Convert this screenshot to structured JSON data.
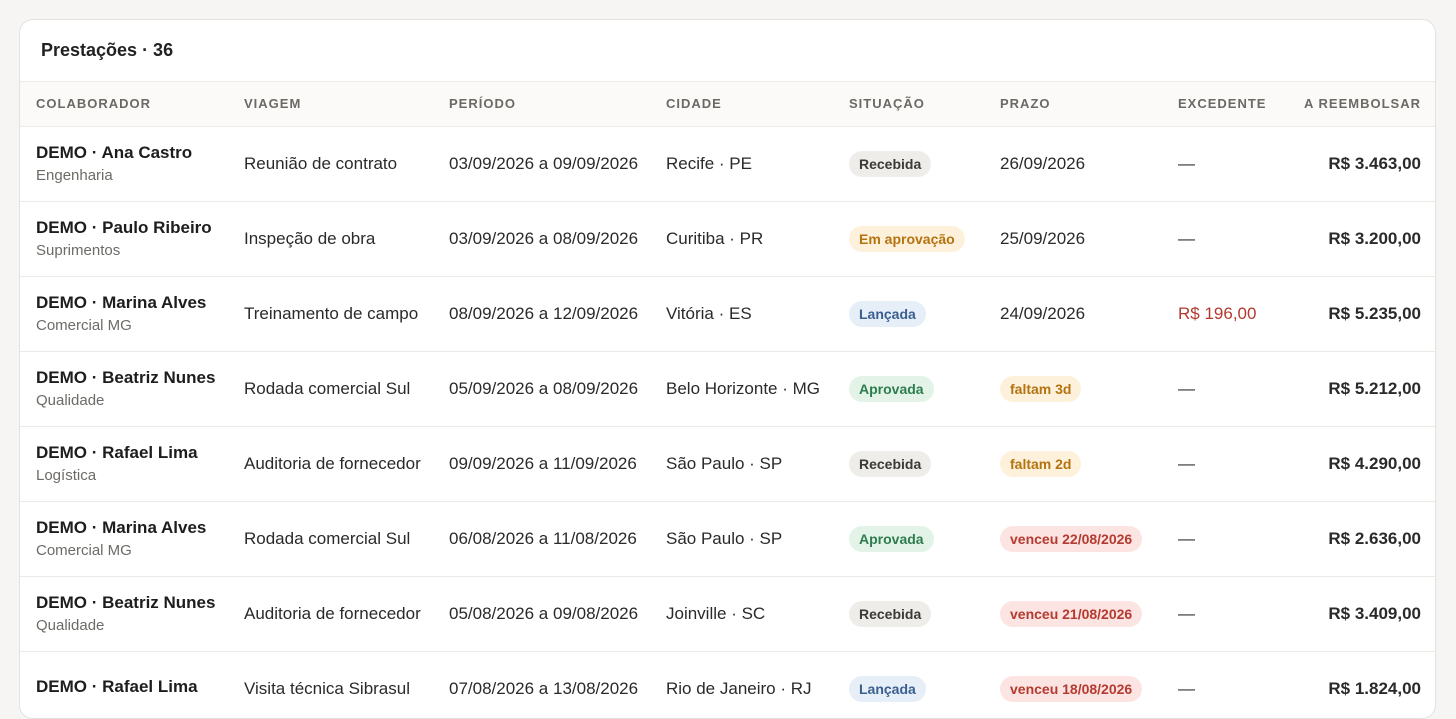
{
  "card": {
    "title": "Prestações · 36"
  },
  "columns": [
    "COLABORADOR",
    "VIAGEM",
    "PERÍODO",
    "CIDADE",
    "SITUAÇÃO",
    "PRAZO",
    "EXCEDENTE",
    "A REEMBOLSAR"
  ],
  "colors": {
    "accent_danger": "#b23a2e",
    "warn": "#b4730f",
    "success": "#2e7d4f",
    "info": "#3a5f8f"
  },
  "rows": [
    {
      "name": "DEMO · Ana Castro",
      "dept": "Engenharia",
      "trip": "Reunião de contrato",
      "period": "03/09/2026 a 09/09/2026",
      "city": "Recife · PE",
      "status": "Recebida",
      "status_kind": "received",
      "deadline": "26/09/2026",
      "deadline_kind": "plain",
      "excess": "—",
      "amount": "R$ 3.463,00"
    },
    {
      "name": "DEMO · Paulo Ribeiro",
      "dept": "Suprimentos",
      "trip": "Inspeção de obra",
      "period": "03/09/2026 a 08/09/2026",
      "city": "Curitiba · PR",
      "status": "Em aprovação",
      "status_kind": "approval",
      "deadline": "25/09/2026",
      "deadline_kind": "plain",
      "excess": "—",
      "amount": "R$ 3.200,00"
    },
    {
      "name": "DEMO · Marina Alves",
      "dept": "Comercial MG",
      "trip": "Treinamento de campo",
      "period": "08/09/2026 a 12/09/2026",
      "city": "Vitória · ES",
      "status": "Lançada",
      "status_kind": "launched",
      "deadline": "24/09/2026",
      "deadline_kind": "plain",
      "excess": "R$ 196,00",
      "amount": "R$ 5.235,00"
    },
    {
      "name": "DEMO · Beatriz Nunes",
      "dept": "Qualidade",
      "trip": "Rodada comercial Sul",
      "period": "05/09/2026 a 08/09/2026",
      "city": "Belo Horizonte · MG",
      "status": "Aprovada",
      "status_kind": "approved",
      "deadline": "faltam 3d",
      "deadline_kind": "warn",
      "excess": "—",
      "amount": "R$ 5.212,00"
    },
    {
      "name": "DEMO · Rafael Lima",
      "dept": "Logística",
      "trip": "Auditoria de fornecedor",
      "period": "09/09/2026 a 11/09/2026",
      "city": "São Paulo · SP",
      "status": "Recebida",
      "status_kind": "received",
      "deadline": "faltam 2d",
      "deadline_kind": "warn",
      "excess": "—",
      "amount": "R$ 4.290,00"
    },
    {
      "name": "DEMO · Marina Alves",
      "dept": "Comercial MG",
      "trip": "Rodada comercial Sul",
      "period": "06/08/2026 a 11/08/2026",
      "city": "São Paulo · SP",
      "status": "Aprovada",
      "status_kind": "approved",
      "deadline": "venceu 22/08/2026",
      "deadline_kind": "late",
      "excess": "—",
      "amount": "R$ 2.636,00"
    },
    {
      "name": "DEMO · Beatriz Nunes",
      "dept": "Qualidade",
      "trip": "Auditoria de fornecedor",
      "period": "05/08/2026 a 09/08/2026",
      "city": "Joinville · SC",
      "status": "Recebida",
      "status_kind": "received",
      "deadline": "venceu 21/08/2026",
      "deadline_kind": "late",
      "excess": "—",
      "amount": "R$ 3.409,00"
    },
    {
      "name": "DEMO · Rafael Lima",
      "dept": "",
      "trip": "Visita técnica Sibrasul",
      "period": "07/08/2026 a 13/08/2026",
      "city": "Rio de Janeiro · RJ",
      "status": "Lançada",
      "status_kind": "launched",
      "deadline": "venceu 18/08/2026",
      "deadline_kind": "late",
      "excess": "—",
      "amount": "R$ 1.824,00"
    }
  ]
}
